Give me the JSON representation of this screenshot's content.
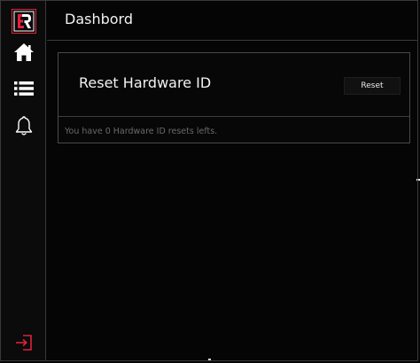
{
  "sidebar": {
    "logo_icon": "brand-logo-icon",
    "items": [
      {
        "icon": "home-icon"
      },
      {
        "icon": "list-icon"
      },
      {
        "icon": "bell-icon"
      }
    ],
    "exit_icon": "logout-icon",
    "accent_color": "#e0213b"
  },
  "header": {
    "title": "Dashbord"
  },
  "card": {
    "title": "Reset Hardware ID",
    "reset_label": "Reset",
    "info_text": "You have 0 Hardware ID resets lefts."
  }
}
